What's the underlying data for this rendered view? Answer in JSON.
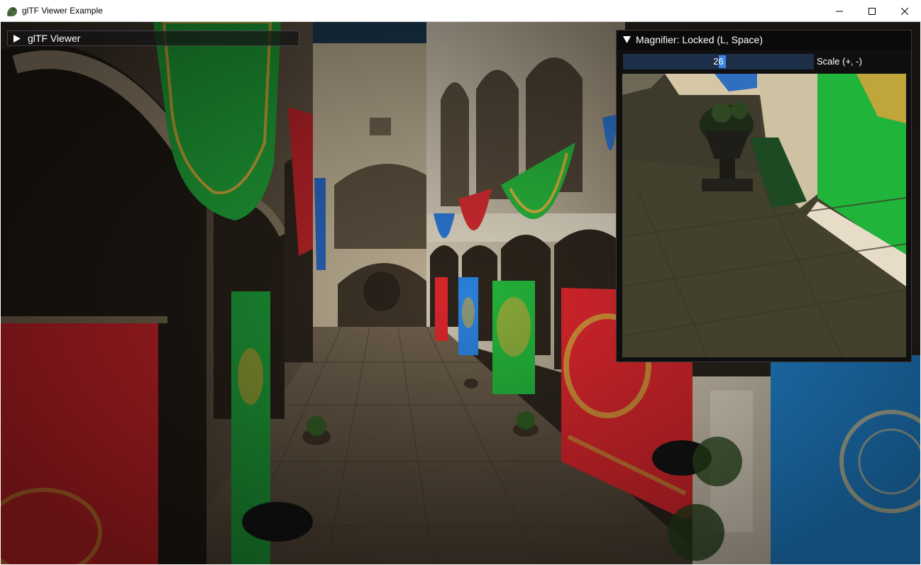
{
  "window": {
    "title": "glTF Viewer Example",
    "icon": "frog-app-icon",
    "controls": [
      "minimize-icon",
      "maximize-icon",
      "close-icon"
    ]
  },
  "gltf_viewer": {
    "label": "glTF Viewer",
    "expanded": false
  },
  "magnifier": {
    "title": "Magnifier: Locked (L, Space)",
    "expanded": true,
    "scale_value": "26",
    "scale_label": "Scale (+, -)"
  },
  "colors": {
    "banner_red": "#d8232a",
    "banner_green": "#1fb23a",
    "banner_blue": "#1f7ed8",
    "stone": "#bfb39b",
    "slider_bg": "#1d2f49",
    "slider_grab": "#3d85e0"
  }
}
